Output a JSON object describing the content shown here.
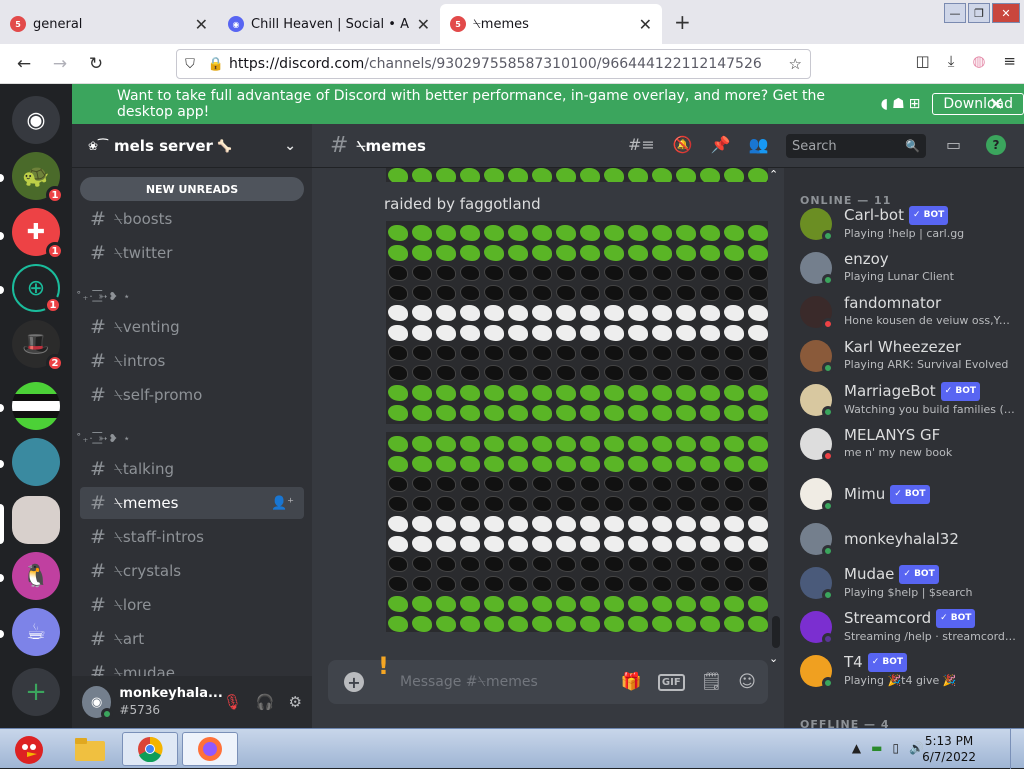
{
  "browser": {
    "tabs": [
      {
        "title": "general",
        "active": false
      },
      {
        "title": "Chill Heaven | Social • Anime",
        "active": false
      },
      {
        "title": "⍀memes",
        "active": true
      }
    ],
    "url_host": "https://discord.com",
    "url_path": "/channels/930297558587310100/966444122112147526"
  },
  "banner": {
    "message": "Want to take full advantage of Discord with better performance, in-game overlay, and more? Get the desktop app!",
    "download_label": "Download"
  },
  "server": {
    "name": "mels server",
    "new_unreads": "NEW UNREADS",
    "categories": [
      "˚₊· ͟͟͞͞➳❥ ⋆",
      "˚₊· ͟͟͞͞➳❥ ⋆"
    ],
    "channels": [
      {
        "name": "⍀boosts"
      },
      {
        "name": "⍀twitter"
      },
      {
        "name": "⍀venting"
      },
      {
        "name": "⍀intros"
      },
      {
        "name": "⍀self-promo"
      },
      {
        "name": "⍀talking"
      },
      {
        "name": "⍀memes"
      },
      {
        "name": "⍀staff-intros"
      },
      {
        "name": "⍀crystals"
      },
      {
        "name": "⍀lore"
      },
      {
        "name": "⍀art"
      },
      {
        "name": "⍀mudae"
      }
    ]
  },
  "server_badges": [
    "1",
    "1",
    "1",
    "2"
  ],
  "user": {
    "name": "monkeyhala...",
    "tag": "#5736"
  },
  "chat": {
    "channel_name": "⍀memes",
    "search_placeholder": "Search",
    "message_text": "raided by faggotland",
    "composer_placeholder": "Message #⍀memes",
    "gif_label": "GIF"
  },
  "members": {
    "online_header": "ONLINE — 11",
    "offline_header": "OFFLINE — 4",
    "bot_label": "✓ BOT",
    "list": [
      {
        "name": "Carl-bot",
        "bot": true,
        "activity": "Playing !help | carl.gg",
        "status": "online",
        "color": "#6b8e23"
      },
      {
        "name": "enzoy",
        "bot": false,
        "activity": "Playing Lunar Client",
        "status": "online",
        "color": "#747f8d"
      },
      {
        "name": "fandomnator",
        "bot": false,
        "activity": "Hone kousen de veiuw oss,Yea ...",
        "status": "dnd",
        "color": "#3a2a2a"
      },
      {
        "name": "Karl Wheezezer",
        "bot": false,
        "activity": "Playing ARK: Survival Evolved",
        "status": "online",
        "color": "#8a5a3a"
      },
      {
        "name": "MarriageBot",
        "bot": true,
        "activity": "Watching you build families (s...",
        "status": "online",
        "color": "#d8c8a0"
      },
      {
        "name": "MELANYS GF",
        "bot": false,
        "activity": "me n' my new book",
        "status": "dnd",
        "color": "#dddddd"
      },
      {
        "name": "Mimu",
        "bot": true,
        "activity": "",
        "status": "online",
        "color": "#f0ece4"
      },
      {
        "name": "monkeyhalal32",
        "bot": false,
        "activity": "",
        "status": "online",
        "color": "#747f8d"
      },
      {
        "name": "Mudae",
        "bot": true,
        "activity": "Playing $help | $search",
        "status": "online",
        "color": "#4a5a7a"
      },
      {
        "name": "Streamcord",
        "bot": true,
        "activity": "Streaming /help · streamcord.io",
        "status": "stream",
        "color": "#7b2fd0"
      },
      {
        "name": "T4",
        "bot": true,
        "activity": "Playing 🎉t4 give 🎉",
        "status": "online",
        "color": "#f0a020"
      }
    ]
  },
  "taskbar": {
    "time": "5:13 PM",
    "date": "6/7/2022"
  }
}
